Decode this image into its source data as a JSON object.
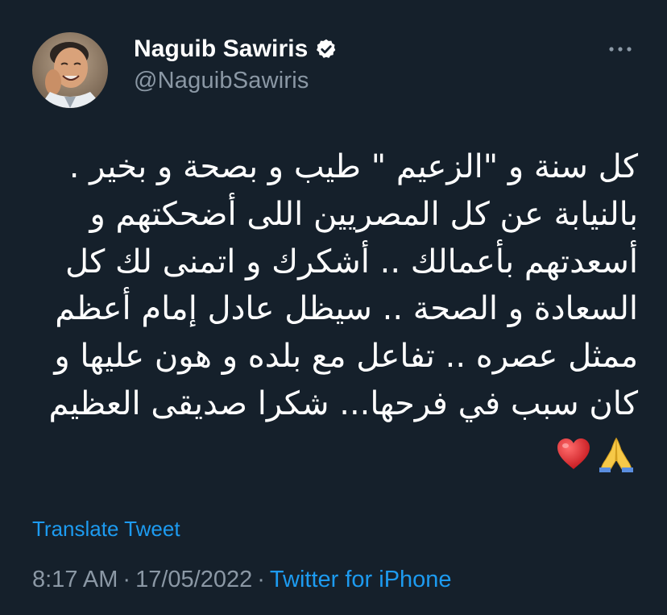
{
  "author": {
    "display_name": "Naguib Sawiris",
    "handle": "@NaguibSawiris",
    "verified": true,
    "avatar_icon": "profile-photo"
  },
  "menu": {
    "more_icon": "more-horizontal-icon"
  },
  "tweet": {
    "lines": [
      "كل سنة و  \"الزعيم \" طيب و بصحة و بخير .",
      "بالنيابة عن كل المصريين اللى أضحكتهم و",
      "أسعدتهم بأعمالك .. أشكرك و اتمنى لك كل",
      "السعادة و الصحة .. سيظل عادل إمام أعظم",
      "ممثل عصره .. تفاعل مع بلده و هون عليها و",
      "كان سبب في فرحها... شكرا صديقى العظيم"
    ],
    "emojis": [
      "folded-hands-emoji",
      "red-heart-emoji"
    ]
  },
  "actions": {
    "translate_label": "Translate Tweet"
  },
  "meta": {
    "time": "8:17 AM",
    "separator": "·",
    "date": "17/05/2022",
    "source": "Twitter for iPhone"
  },
  "colors": {
    "background": "#15202b",
    "text": "#ffffff",
    "secondary": "#8b98a5",
    "accent": "#1d9bf0"
  }
}
